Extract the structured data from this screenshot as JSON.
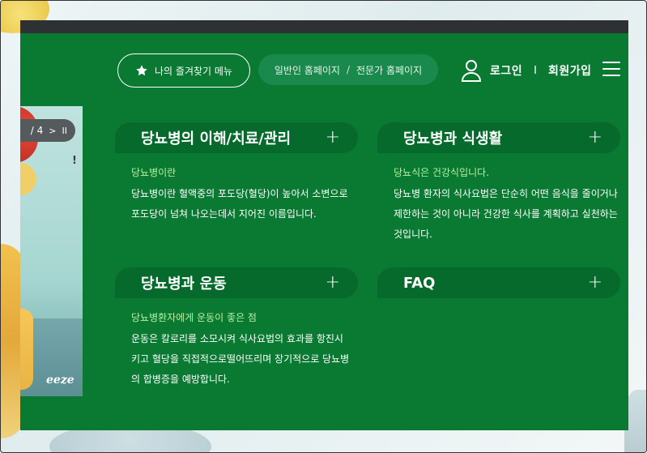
{
  "header": {
    "favorites_label": "나의 즐겨찾기 메뉴",
    "site_switch": {
      "general": "일반인 홈페이지",
      "separator": "/",
      "expert": "전문가 홈페이지"
    },
    "login": "로그인",
    "divider": "I",
    "signup": "회원가입"
  },
  "slider": {
    "page_indicator": "/ 4",
    "next_glyph": ">",
    "pause_glyph": "II",
    "caption_tail": "eeze",
    "exclaim": "!"
  },
  "cards": [
    {
      "title": "당뇨병의 이해/치료/관리",
      "plus": "+",
      "subtitle": "당뇨병이란",
      "description": "당뇨병이란 혈액중의 포도당(혈당)이 높아서 소변으로 포도당이 넘쳐 나오는데서 지어진 이름입니다."
    },
    {
      "title": "당뇨병과 식생활",
      "plus": "+",
      "subtitle": "당뇨식은 건강식입니다.",
      "description": "당뇨병 환자의 식사요법은 단순히 어떤 음식을 줄이거나 제한하는 것이 아니라 건강한 식사를 계획하고 실천하는 것입니다."
    },
    {
      "title": "당뇨병과 운동",
      "plus": "+",
      "subtitle": "당뇨병환자에게 운동이 좋은 점",
      "description": "운동은 칼로리를 소모시켜 식사요법의 효과를 항진시키고 혈당을 직접적으로떨어뜨리며 장기적으로 당뇨병의 합병증을 예방합니다."
    },
    {
      "title": "FAQ",
      "plus": "+"
    }
  ],
  "colors": {
    "panel": "#0a7a33",
    "card_header": "#056a2b",
    "subtitle": "#b6f0a0",
    "topbar": "#2e3133"
  }
}
